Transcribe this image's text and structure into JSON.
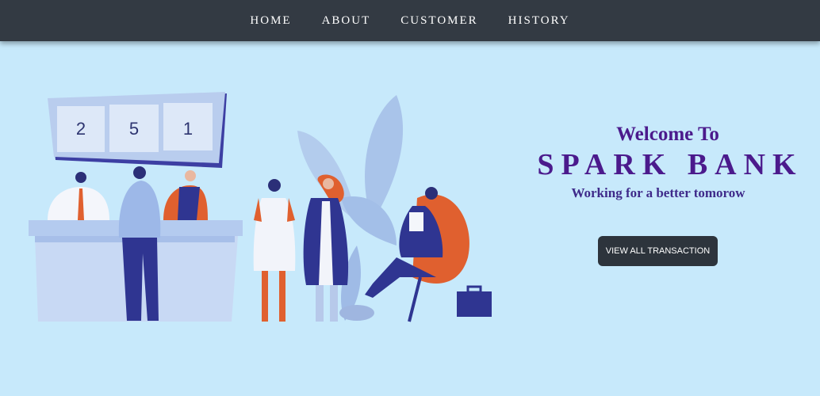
{
  "nav": {
    "items": [
      {
        "label": "HOME"
      },
      {
        "label": "ABOUT"
      },
      {
        "label": "CUSTOMER"
      },
      {
        "label": "HISTORY"
      }
    ]
  },
  "hero": {
    "queue_display": [
      "2",
      "5",
      "1"
    ],
    "welcome": "Welcome To",
    "bank_name": "SPARK  BANK",
    "tagline": "Working for a better tomorow",
    "cta_label": "VIEW ALL TRANSACTION"
  },
  "colors": {
    "navbar": "#333a43",
    "background": "#c7e9fb",
    "brand_purple": "#4b1a8c",
    "button": "#2d343c"
  }
}
